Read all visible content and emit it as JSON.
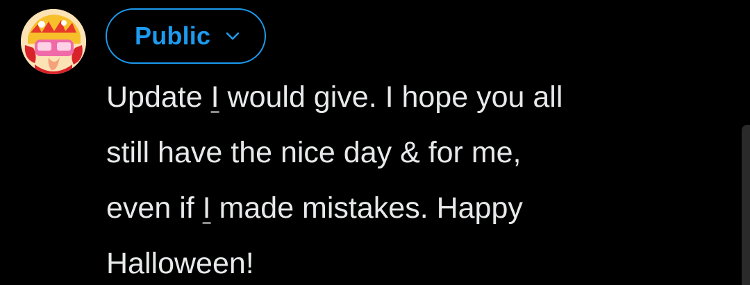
{
  "composer": {
    "audience_label": "Public",
    "avatar_icon": "user-avatar-icon",
    "chevron_icon": "chevron-down-icon",
    "accent_color": "#1d9bf0",
    "text_color": "#e7e9ea",
    "lines": [
      {
        "before": "Update ",
        "flagged": "I",
        "after": " would give. I hope you all"
      },
      {
        "text": "still have the nice day & for me,"
      },
      {
        "before": "even if ",
        "flagged": "I",
        "after": " made mistakes. Happy"
      },
      {
        "text": "Halloween!"
      }
    ]
  }
}
